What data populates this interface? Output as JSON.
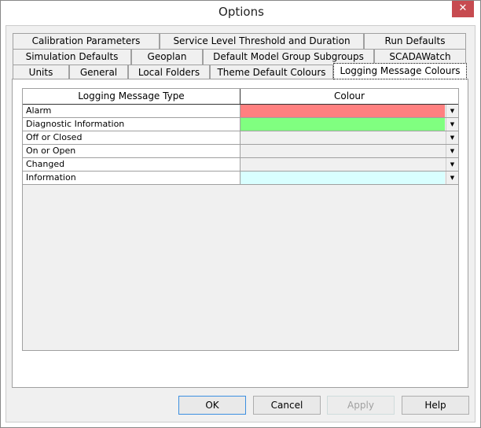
{
  "window": {
    "title": "Options",
    "close_icon": "close-icon"
  },
  "tabs": {
    "row1": [
      "Calibration Parameters",
      "Service Level Threshold and Duration",
      "Run Defaults"
    ],
    "row2": [
      "Simulation Defaults",
      "Geoplan",
      "Default Model Group Subgroups",
      "SCADAWatch"
    ],
    "row3": [
      "Units",
      "General",
      "Local Folders",
      "Theme Default Colours",
      "Logging Message Colours"
    ],
    "selected": "Logging Message Colours"
  },
  "grid": {
    "headers": [
      "Logging Message Type",
      "Colour"
    ],
    "rows": [
      {
        "type": "Alarm",
        "colour": "#ff8080"
      },
      {
        "type": "Diagnostic Information",
        "colour": "#80ff80"
      },
      {
        "type": "Off or Closed",
        "colour": "#f0f0f0"
      },
      {
        "type": "On or Open",
        "colour": "#f0f0f0"
      },
      {
        "type": "Changed",
        "colour": "#f0f0f0"
      },
      {
        "type": "Information",
        "colour": "#d9ffff"
      }
    ]
  },
  "buttons": {
    "ok": "OK",
    "cancel": "Cancel",
    "apply": "Apply",
    "help": "Help"
  }
}
